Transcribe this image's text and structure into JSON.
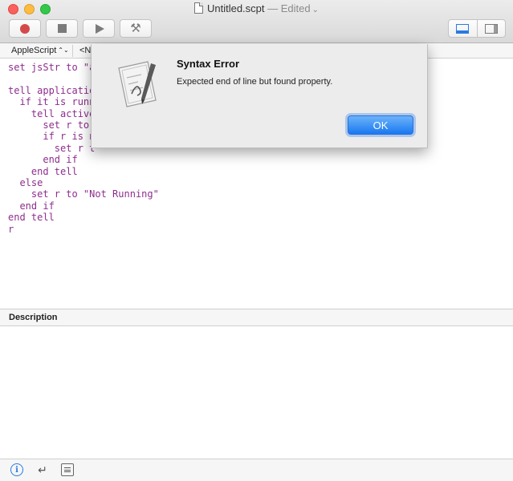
{
  "window": {
    "title": "Untitled.scpt",
    "edited": "— Edited",
    "chevron": "⌄"
  },
  "toolbar": {
    "record": "record-icon",
    "stop": "stop-icon",
    "run": "run-icon",
    "compile": "hammer-icon",
    "hammer_glyph": "⚒"
  },
  "navbar": {
    "language": "AppleScript",
    "handler": "<N"
  },
  "editor": {
    "lines": [
      "set jsStr to \"a",
      "",
      "tell applicatio",
      "  if it is runn",
      "    tell active",
      "      set r to",
      "      if r is n",
      "        set r t",
      "      end if",
      "    end tell",
      "  else",
      "    set r to \"Not Running\"",
      "  end if",
      "end tell",
      "r"
    ]
  },
  "description": {
    "header": "Description"
  },
  "bottom_bar": {
    "info": "i",
    "return_glyph": "↵"
  },
  "dialog": {
    "title": "Syntax Error",
    "message": "Expected end of line but found property.",
    "ok_label": "OK"
  },
  "colors": {
    "code_text": "#8e2d8e",
    "accent": "#1978f0"
  }
}
